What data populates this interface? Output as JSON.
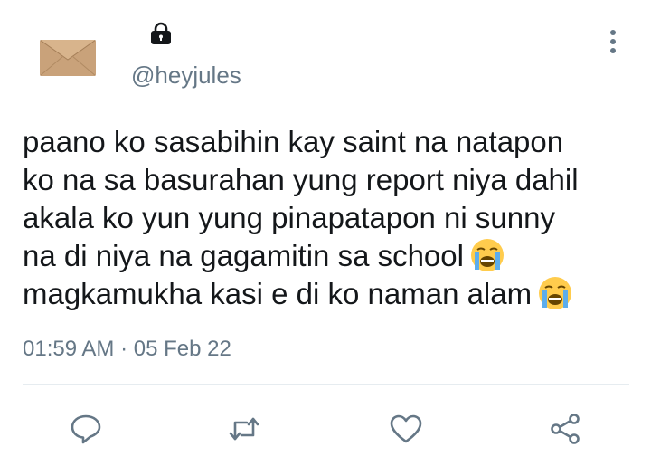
{
  "tweet": {
    "display_name": "",
    "handle": "@heyjules",
    "text_lines": [
      "paano ko sasabihin kay saint na natapon",
      "ko na sa basurahan yung report niya dahil",
      "akala ko yun yung pinapatapon ni sunny",
      "na di niya na gagamitin sa school",
      "magkamukha kasi e di ko naman alam"
    ],
    "time": "01:59 AM",
    "separator": "·",
    "date": "05 Feb 22"
  },
  "icons": {
    "avatar": "envelope-image",
    "protected": "lock-icon",
    "more": "more-vertical-icon",
    "emoji": "loudly-crying-face",
    "actions": [
      "reply-icon",
      "retweet-icon",
      "like-icon",
      "share-icon"
    ]
  },
  "colors": {
    "text": "#14171a",
    "secondary": "#657786",
    "divider": "#e6ecf0"
  }
}
